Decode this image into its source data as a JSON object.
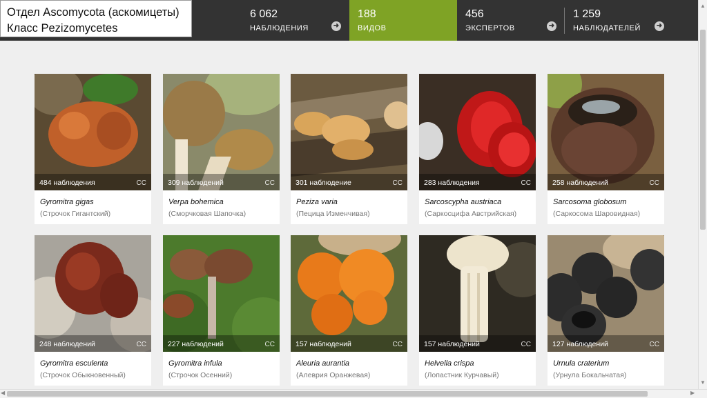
{
  "header": {
    "title_line1": "Отдел Ascomycota (аскомицеты)",
    "title_line2": "Класс Pezizomycetes",
    "stats": [
      {
        "value": "6 062",
        "label": "НАБЛЮДЕНИЯ"
      },
      {
        "value": "188",
        "label": "ВИДОВ"
      },
      {
        "value": "456",
        "label": "ЭКСПЕРТОВ"
      },
      {
        "value": "1 259",
        "label": "НАБЛЮДАТЕЛЕЙ"
      }
    ],
    "arrow_glyph": "➜",
    "active_color": "#7fa325"
  },
  "cards": [
    {
      "obs": "484 наблюдения",
      "cc": "CC",
      "sci": "Gyromitra gigas",
      "common": "(Строчок Гигантский)"
    },
    {
      "obs": "309 наблюдений",
      "cc": "CC",
      "sci": "Verpa bohemica",
      "common": "(Сморчковая Шапочка)"
    },
    {
      "obs": "301 наблюдение",
      "cc": "CC",
      "sci": "Peziza varia",
      "common": "(Пецица Изменчивая)"
    },
    {
      "obs": "283 наблюдения",
      "cc": "CC",
      "sci": "Sarcoscypha austriaca",
      "common": "(Саркосцифа Австрийская)"
    },
    {
      "obs": "258 наблюдений",
      "cc": "CC",
      "sci": "Sarcosoma globosum",
      "common": "(Саркосома Шаровидная)"
    },
    {
      "obs": "248 наблюдений",
      "cc": "CC",
      "sci": "Gyromitra esculenta",
      "common": "(Строчок Обыкновенный)"
    },
    {
      "obs": "227 наблюдений",
      "cc": "CC",
      "sci": "Gyromitra infula",
      "common": "(Строчок Осенний)"
    },
    {
      "obs": "157 наблюдений",
      "cc": "CC",
      "sci": "Aleuria aurantia",
      "common": "(Алеврия Оранжевая)"
    },
    {
      "obs": "157 наблюдений",
      "cc": "CC",
      "sci": "Helvella crispa",
      "common": "(Лопастник Курчавый)"
    },
    {
      "obs": "127 наблюдений",
      "cc": "CC",
      "sci": "Urnula craterium",
      "common": "(Урнула Бокальчатая)"
    }
  ]
}
